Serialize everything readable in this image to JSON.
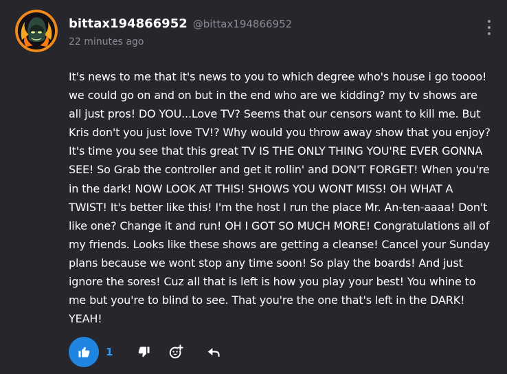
{
  "post": {
    "username": "bittax194866952",
    "handle": "@bittax194866952",
    "time": "22 minutes ago",
    "body": "It's news to me that it's news to you to which degree who's house i go toooo! we could go on and on but in the end who are we kidding? my tv shows are all just pros! DO YOU...Love TV? Seems that our censors want to kill me. But Kris don't you just love TV!? Why would you throw away show that you enjoy? It's time you see that this great TV IS THE ONLY THING YOU'RE EVER GONNA SEE! So Grab the controller and get it rollin' and DON'T FORGET! When you're in the dark! NOW LOOK AT THIS! SHOWS YOU WONT MISS! OH WHAT A TWIST! It's better like this! I'm the host I run the place Mr. An-ten-aaaa! Don't like one? Change it and run! OH I GOT SO MUCH MORE! Congratulations all of my friends. Looks like these shows are getting a cleanse! Cancel your Sunday plans because we wont stop any time soon! So play the boards! And just ignore the sores! Cuz all that is left is how you play your best! You whine to me but you're to blind to see. That you're the one that's left in the DARK! YEAH!",
    "like_count": "1"
  },
  "icons": {
    "menu": "more-vertical-icon",
    "like": "thumbs-up-icon",
    "dislike": "thumbs-down-icon",
    "react": "add-emoji-icon",
    "reply": "reply-icon"
  },
  "colors": {
    "background": "#27262c",
    "text": "#ffffff",
    "muted": "#8c8a92",
    "accent": "#1f85e0"
  }
}
